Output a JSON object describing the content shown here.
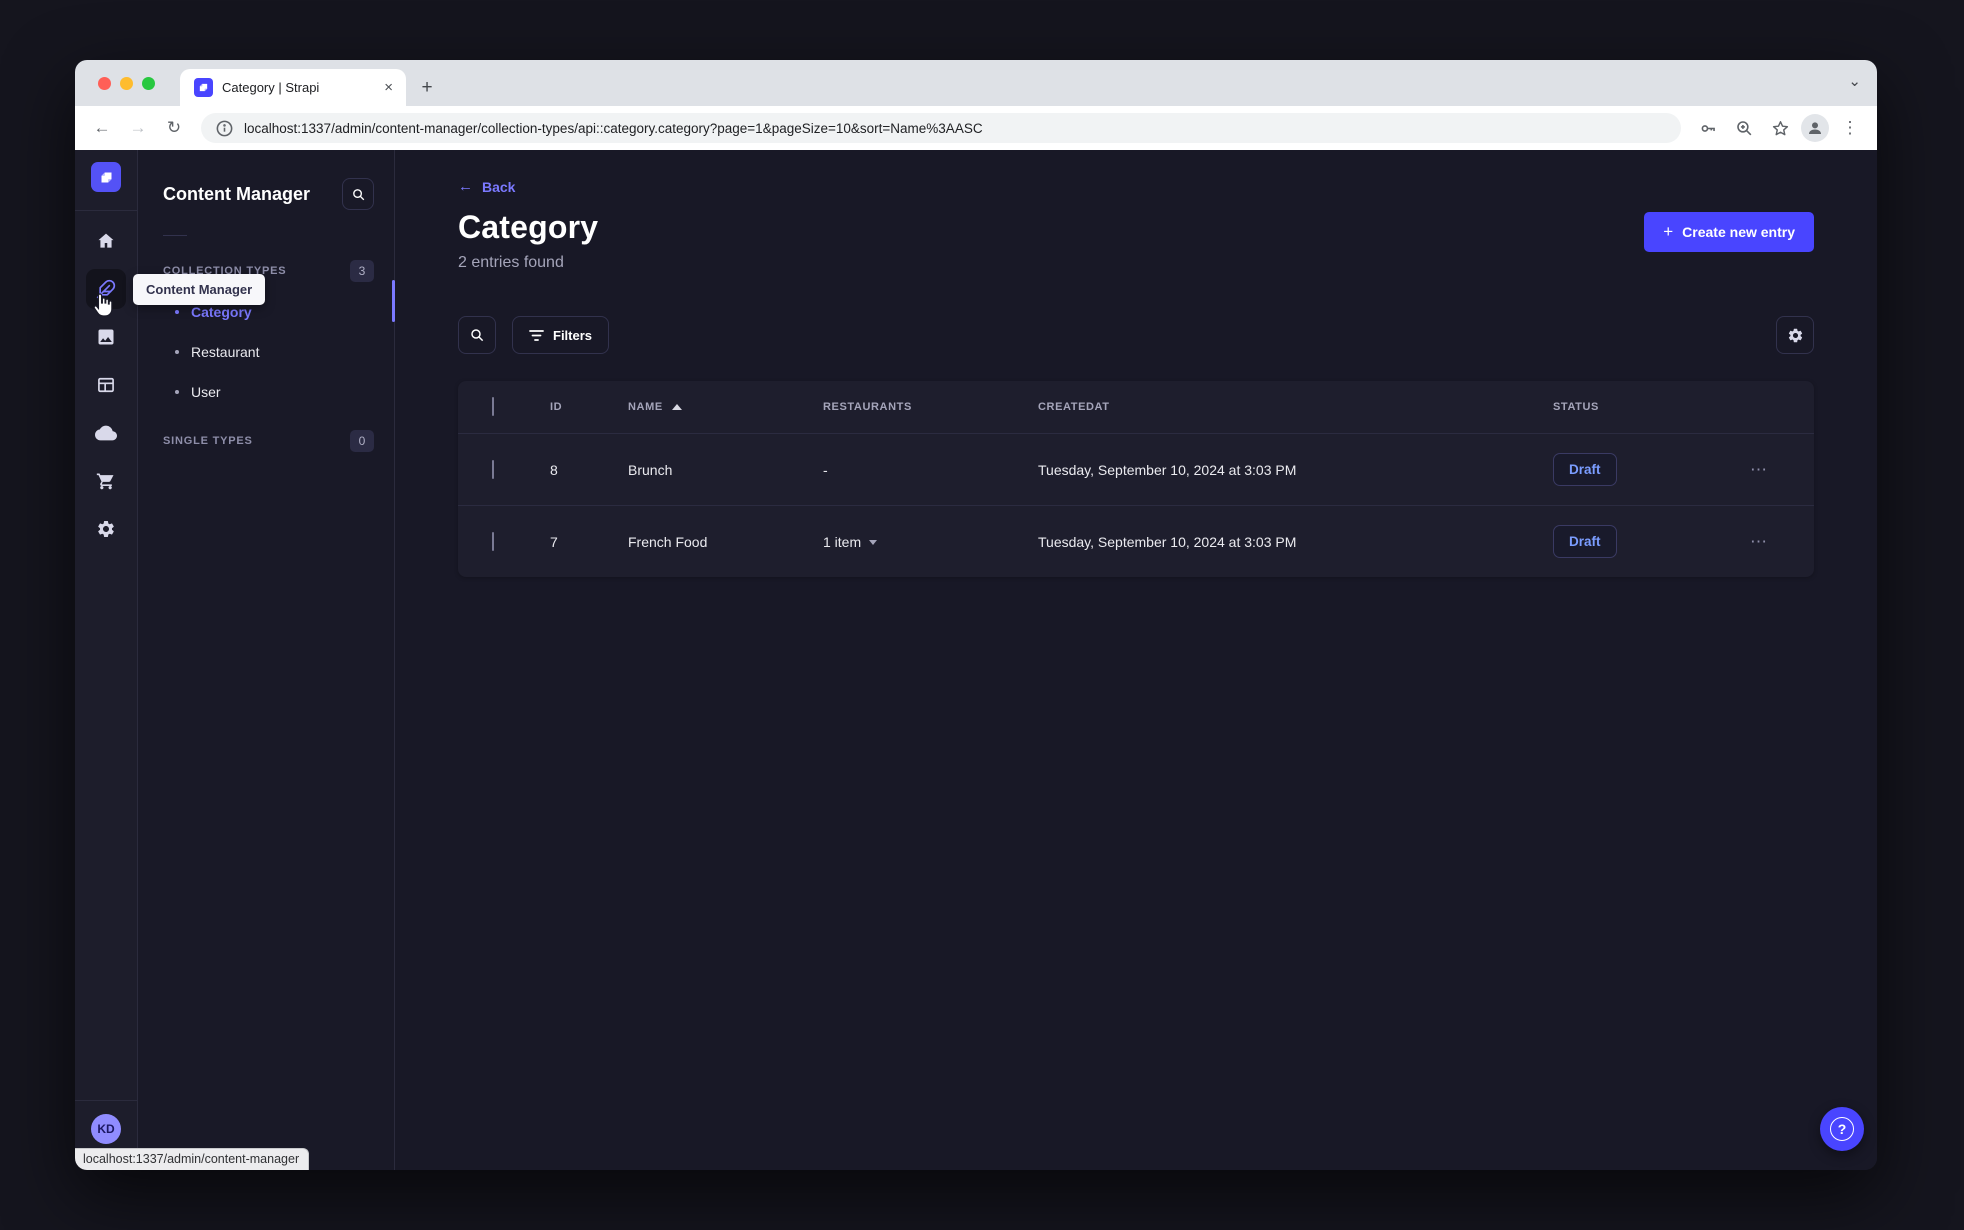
{
  "browser": {
    "tab_title": "Category | Strapi",
    "close_glyph": "×",
    "new_tab_glyph": "+",
    "tab_overflow_glyph": "⌄",
    "back_glyph": "←",
    "forward_glyph": "→",
    "reload_glyph": "↻",
    "menu_glyph": "⋮",
    "url": "localhost:1337/admin/content-manager/collection-types/api::category.category?page=1&pageSize=10&sort=Name%3AASC",
    "status_bar": "localhost:1337/admin/content-manager"
  },
  "nav": {
    "tooltip": "Content Manager",
    "avatar_initials": "KD"
  },
  "subnav": {
    "title": "Content Manager",
    "sections": [
      {
        "label": "COLLECTION TYPES",
        "count": "3"
      },
      {
        "label": "SINGLE TYPES",
        "count": "0"
      }
    ],
    "items": [
      {
        "label": "Category"
      },
      {
        "label": "Restaurant"
      },
      {
        "label": "User"
      }
    ]
  },
  "content": {
    "back_label": "Back",
    "back_arrow": "←",
    "title": "Category",
    "subtitle": "2 entries found",
    "create_plus": "+",
    "create_label": "Create new entry",
    "filters_label": "Filters",
    "more_glyph": "⋯",
    "help_glyph": "?",
    "table": {
      "headers": {
        "id": "ID",
        "name": "NAME",
        "restaurants": "RESTAURANTS",
        "createdat": "CREATEDAT",
        "status": "STATUS"
      },
      "rows": [
        {
          "id": "8",
          "name": "Brunch",
          "restaurants": "-",
          "createdat": "Tuesday, September 10, 2024 at 3:03 PM",
          "status": "Draft"
        },
        {
          "id": "7",
          "name": "French Food",
          "restaurants": "1 item",
          "createdat": "Tuesday, September 10, 2024 at 3:03 PM",
          "status": "Draft"
        }
      ]
    }
  },
  "colors": {
    "primary": "#4945ff",
    "link": "#7b79ff",
    "draft_text": "#7b9dff"
  }
}
